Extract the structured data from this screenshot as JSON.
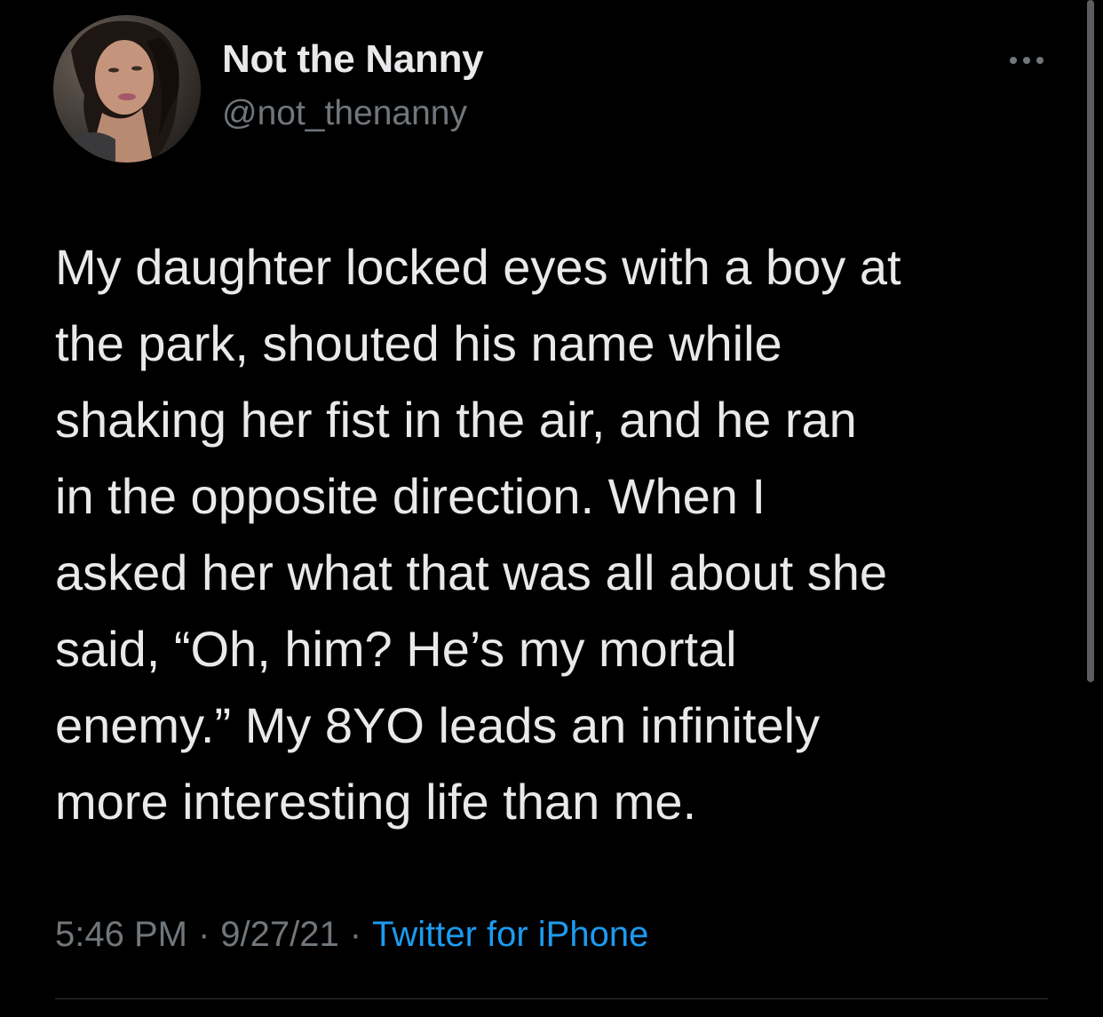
{
  "author": {
    "display_name": "Not the Nanny",
    "handle": "@not_thenanny",
    "avatar_icon": "profile-photo"
  },
  "more_icon": "more-options-icon",
  "tweet": {
    "text": "My daughter locked eyes with a boy at\nthe park, shouted his name while\nshaking her fist in the air, and he ran\nin the opposite direction. When I\nasked her what that was all about she\nsaid, “Oh, him? He’s my mortal\nenemy.” My 8YO leads an infinitely\nmore interesting life than me."
  },
  "meta": {
    "time": "5:46 PM",
    "separator": "·",
    "date": "9/27/21",
    "source": "Twitter for iPhone"
  },
  "colors": {
    "background": "#000000",
    "primary_text": "#e7e9ea",
    "secondary_text": "#71767b",
    "link": "#1d9bf0"
  }
}
